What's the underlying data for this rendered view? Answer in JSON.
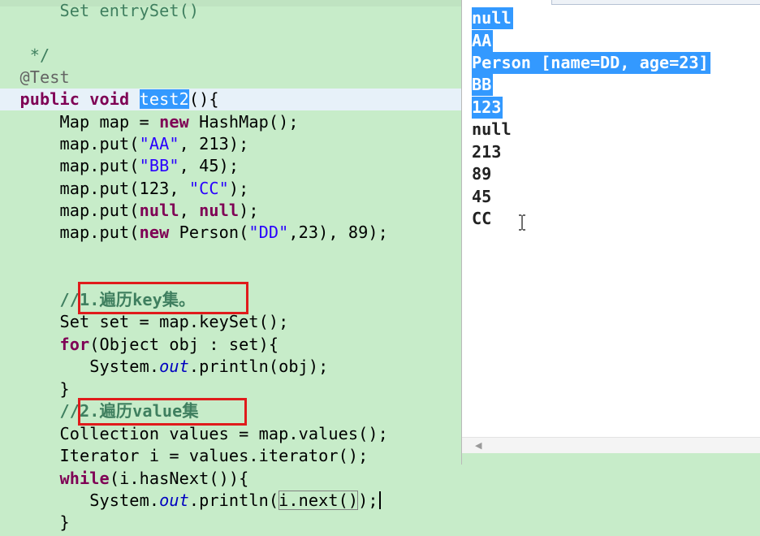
{
  "editor": {
    "lines": {
      "entryset_comment": "Set entrySet()",
      "comment_end": "*/",
      "annotation": "@Test",
      "method_kw": "public void",
      "method_name": "test2",
      "method_tail": "(){",
      "map_decl_type": "Map map = ",
      "kw_new": "new",
      "map_decl_tail": " HashMap();",
      "put_aa_head": "map.put(",
      "put_aa_str": "\"AA\"",
      "put_aa_tail": ", 213);",
      "put_bb_head": "map.put(",
      "put_bb_str": "\"BB\"",
      "put_bb_tail": ", 45);",
      "put_123_head": "map.put(123, ",
      "put_123_str": "\"CC\"",
      "put_123_tail": ");",
      "put_null_head": "map.put(",
      "kw_null_1": "null",
      "put_null_mid": ", ",
      "kw_null_2": "null",
      "put_null_tail": ");",
      "put_person_head": "map.put(",
      "kw_new_2": "new",
      "put_person_mid": " Person(",
      "put_person_str": "\"DD\"",
      "put_person_tail": ",23), 89);",
      "comment_keyset": "//1.遍历key集。",
      "set_decl": "Set set = map.keySet();",
      "kw_for": "for",
      "for_tail": "(Object obj : set){",
      "print1_head": "System.",
      "print1_out": "out",
      "print1_tail": ".println(obj);",
      "close_brace_1": "}",
      "comment_values": "//2.遍历value集",
      "collection_decl": "Collection values = map.values();",
      "iterator_decl": "Iterator i = values.iterator();",
      "kw_while": "while",
      "while_tail": "(i.hasNext()){",
      "print2_head": "System.",
      "print2_out": "out",
      "print2_mid": ".println(",
      "print2_boxed": "i.next()",
      "print2_tail": ");",
      "close_brace_2": "}"
    }
  },
  "console": {
    "output": [
      {
        "text": "null",
        "selected": true
      },
      {
        "text": "AA",
        "selected": true
      },
      {
        "text": "Person [name=DD, age=23]",
        "selected": true
      },
      {
        "text": "BB",
        "selected": true
      },
      {
        "text": "123",
        "selected": true
      },
      {
        "text": "null",
        "selected": false
      },
      {
        "text": "213",
        "selected": false
      },
      {
        "text": "89",
        "selected": false
      },
      {
        "text": "45",
        "selected": false
      },
      {
        "text": "CC",
        "selected": false
      }
    ],
    "scroll_left_icon": "chevron-left-icon"
  },
  "colors": {
    "editor_bg": "#c7ecc9",
    "keyword": "#7f0055",
    "string": "#2a00ff",
    "comment": "#3f7f5f",
    "static_field": "#0000c0",
    "selection": "#3399ff",
    "highlight_box": "#e01b1b"
  }
}
